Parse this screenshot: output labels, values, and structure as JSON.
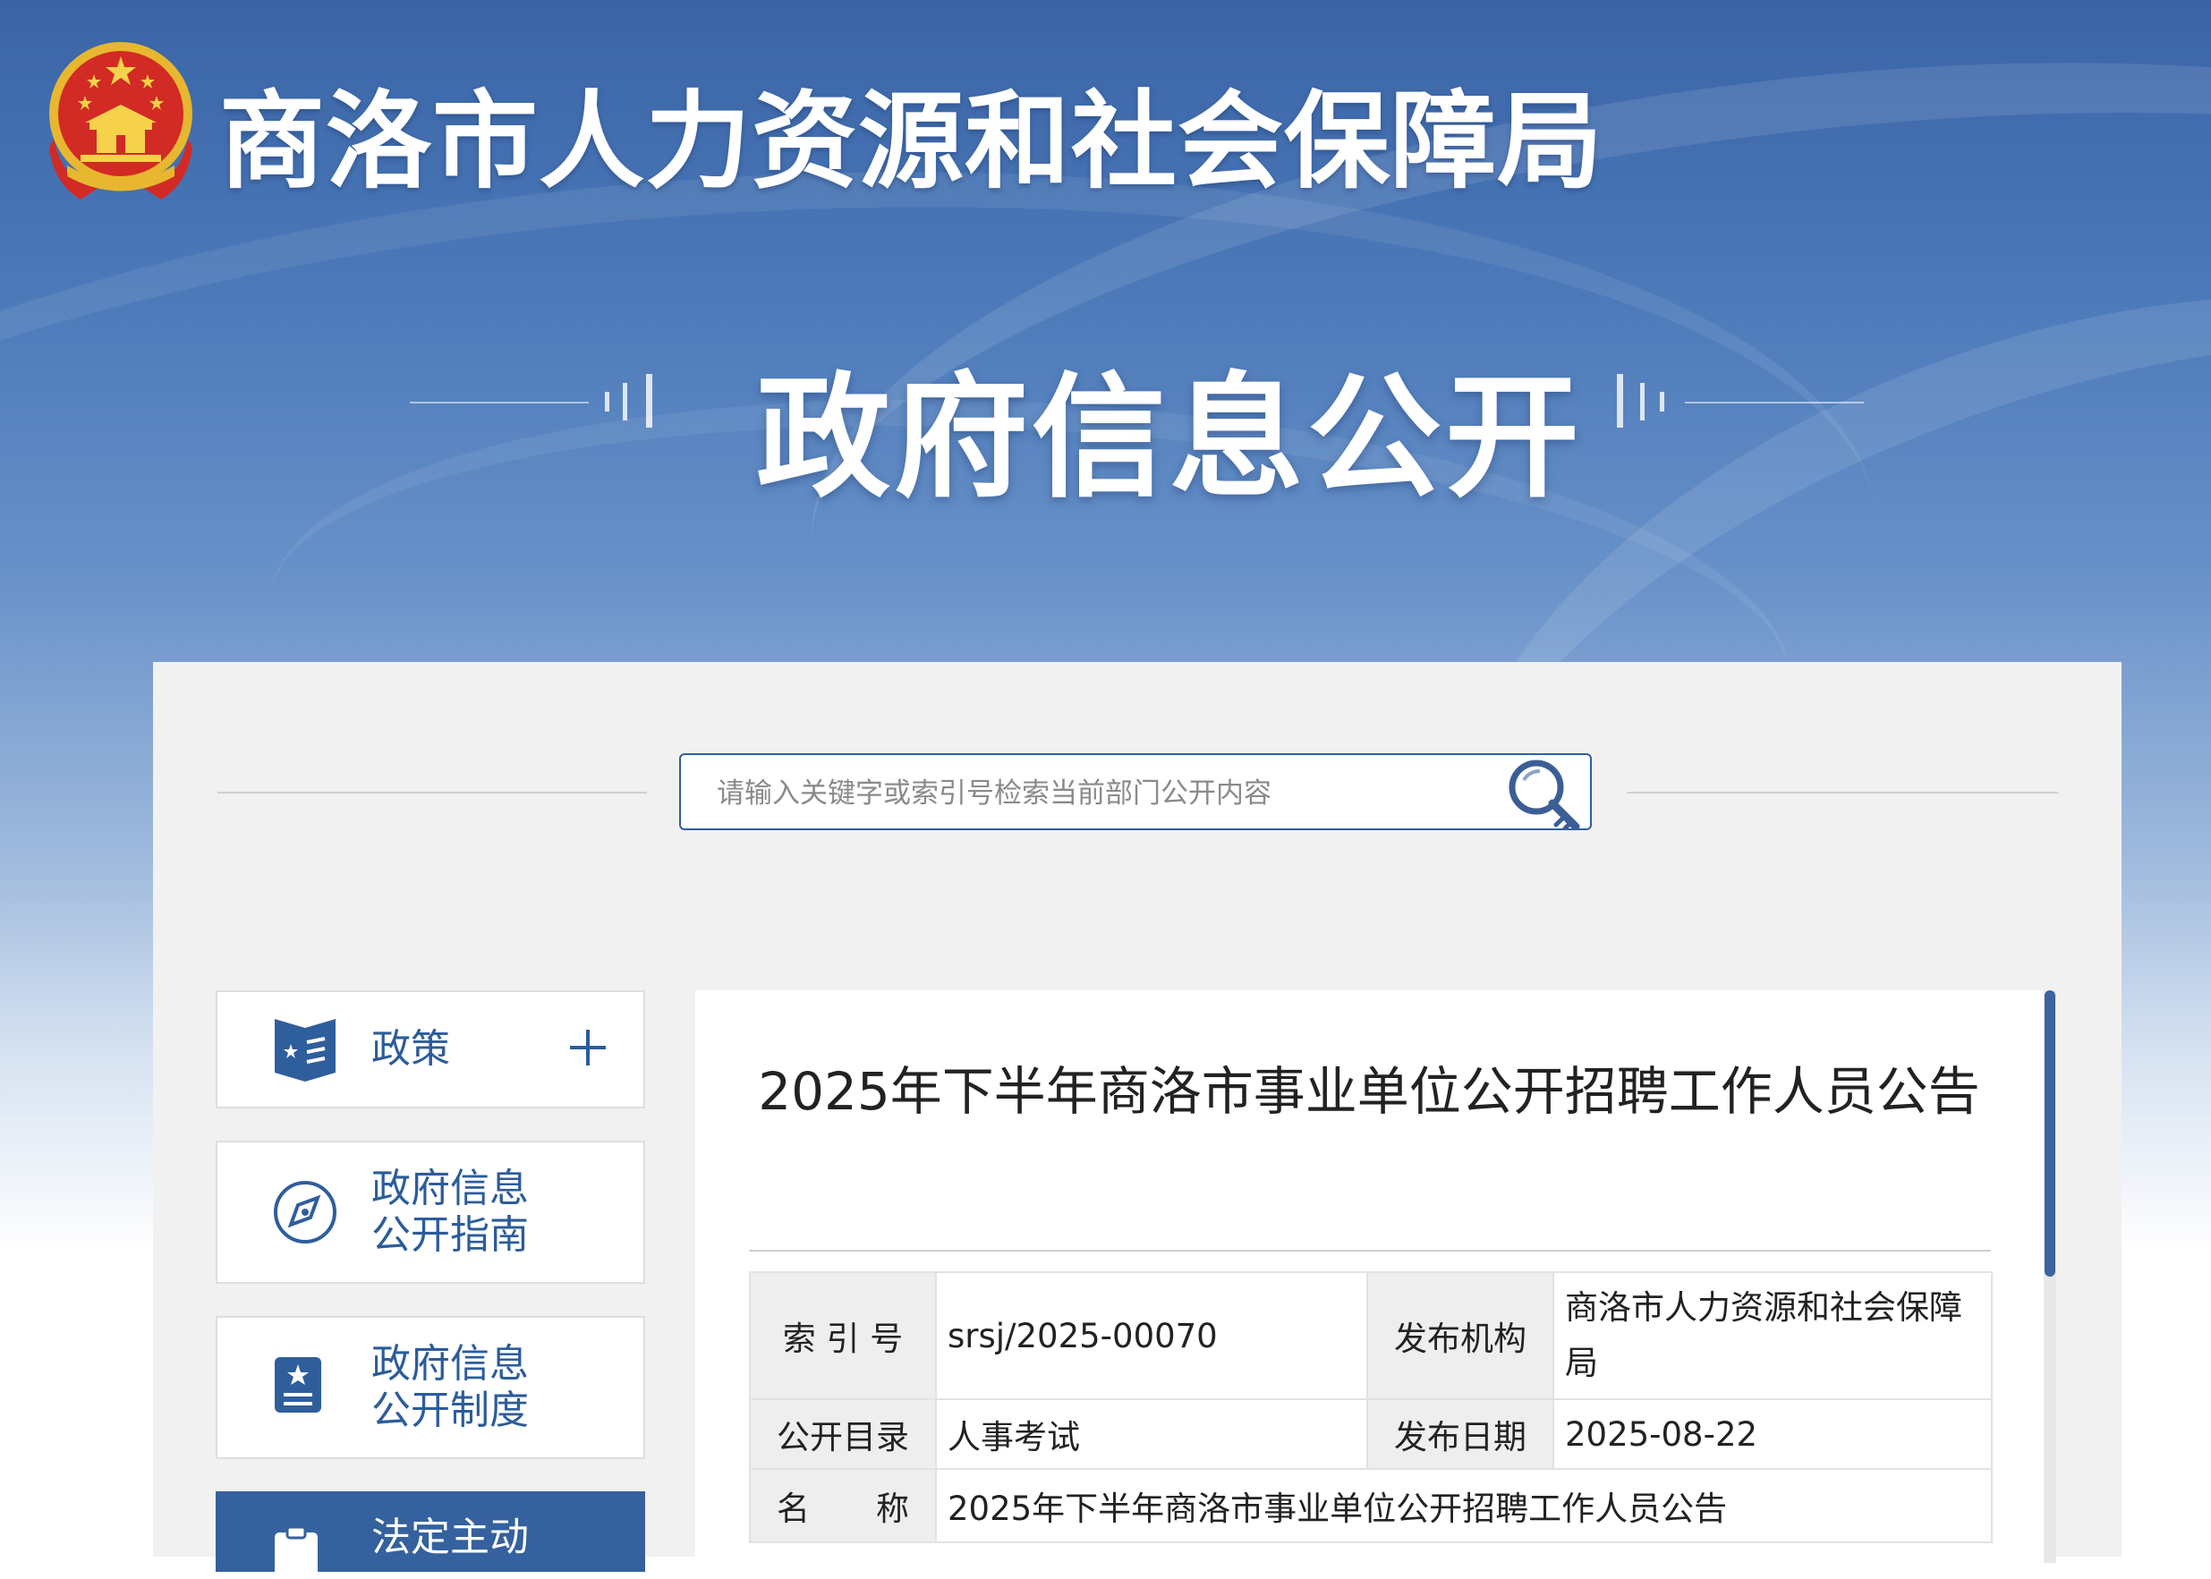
{
  "header": {
    "site_title": "商洛市人力资源和社会保障局",
    "section_title": "政府信息公开"
  },
  "search": {
    "placeholder": "请输入关键字或索引号检索当前部门公开内容"
  },
  "sidebar": {
    "items": [
      {
        "label": "政策",
        "icon": "policy-book-icon",
        "expandable": true
      },
      {
        "label": "政府信息\n公开指南",
        "icon": "compass-icon"
      },
      {
        "label": "政府信息\n公开制度",
        "icon": "document-badge-icon"
      },
      {
        "label": "法定主动",
        "icon": "clipboard-icon",
        "active": true
      }
    ]
  },
  "article": {
    "title": "2025年下半年商洛市事业单位公开招聘工作人员公告",
    "meta": {
      "index_label": "索 引 号",
      "index_value": "srsj/2025-00070",
      "publisher_label": "发布机构",
      "publisher_value": "商洛市人力资源和社会保障局",
      "category_label": "公开目录",
      "category_value": "人事考试",
      "date_label": "发布日期",
      "date_value": "2025-08-22",
      "name_label": "名　　称",
      "name_value": "2025年下半年商洛市事业单位公开招聘工作人员公告"
    }
  },
  "colors": {
    "primary_blue": "#35619e",
    "label_blue": "#2c5c9a",
    "panel_gray": "#f1f1f1"
  }
}
